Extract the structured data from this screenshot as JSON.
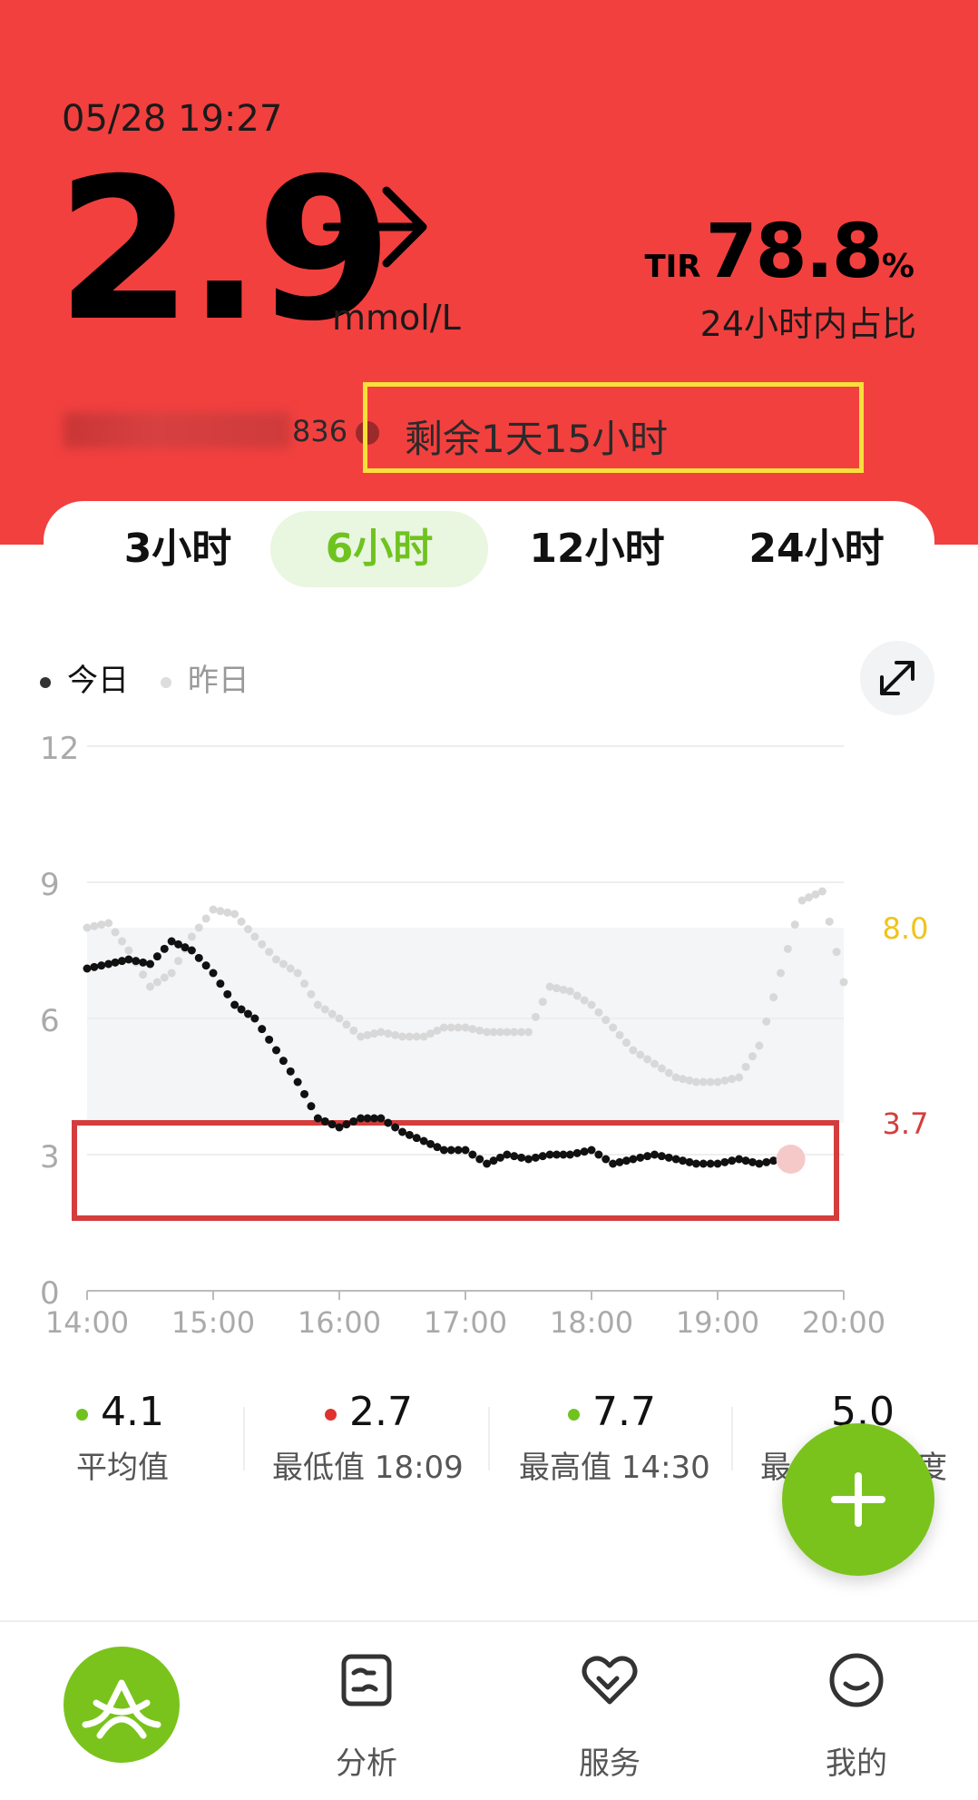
{
  "header": {
    "datetime": "05/28 19:27",
    "glucose_value": "2.9",
    "unit": "mmol/L",
    "trend_icon": "arrow-right-icon",
    "tir_label": "TIR",
    "tir_value": "78.8",
    "tir_pct": "%",
    "tir_sub": "24小时内占比",
    "serial_suffix": "836",
    "remaining": "剩余1天15小时",
    "colors": {
      "background": "#f2403f",
      "highlight_box": "#f7e03a"
    }
  },
  "tabs": [
    {
      "label": "3小时",
      "active": false
    },
    {
      "label": "6小时",
      "active": true
    },
    {
      "label": "12小时",
      "active": false
    },
    {
      "label": "24小时",
      "active": false
    }
  ],
  "legend": {
    "today": "今日",
    "yesterday": "昨日"
  },
  "expand_icon": "expand-arrows-icon",
  "chart_data": {
    "type": "scatter",
    "x_ticks": [
      "14:00",
      "15:00",
      "16:00",
      "17:00",
      "18:00",
      "19:00",
      "20:00"
    ],
    "y_ticks": [
      0,
      3,
      6,
      9,
      12
    ],
    "ylim": [
      0,
      12
    ],
    "target_range": {
      "low": 3.7,
      "high": 8.0,
      "low_label": "3.7",
      "high_label": "8.0"
    },
    "colors": {
      "today": "#111111",
      "yesterday": "#d8d8d8",
      "low_line": "#d43d3d",
      "high_line": "#f0c419",
      "target_band": "#f4f5f7",
      "annotation_box": "#d43d3d"
    },
    "series": [
      {
        "name": "今日",
        "x": [
          0,
          0.17,
          0.33,
          0.5,
          0.67,
          0.83,
          1.0,
          1.17,
          1.33,
          1.5,
          1.67,
          1.83,
          2.0,
          2.17,
          2.33,
          2.5,
          2.67,
          2.83,
          3.0,
          3.17,
          3.33,
          3.5,
          3.67,
          3.83,
          4.0,
          4.17,
          4.33,
          4.5,
          4.67,
          4.83,
          5.0,
          5.17,
          5.33,
          5.5
        ],
        "y": [
          7.1,
          7.2,
          7.3,
          7.2,
          7.7,
          7.5,
          7.0,
          6.3,
          6.0,
          5.3,
          4.6,
          3.8,
          3.6,
          3.8,
          3.8,
          3.5,
          3.3,
          3.1,
          3.1,
          2.8,
          3.0,
          2.9,
          3.0,
          3.0,
          3.1,
          2.8,
          2.9,
          3.0,
          2.9,
          2.8,
          2.8,
          2.9,
          2.8,
          2.9
        ]
      },
      {
        "name": "昨日",
        "x": [
          0,
          0.17,
          0.33,
          0.5,
          0.67,
          0.83,
          1.0,
          1.17,
          1.33,
          1.5,
          1.67,
          1.83,
          2.0,
          2.17,
          2.33,
          2.5,
          2.67,
          2.83,
          3.0,
          3.17,
          3.33,
          3.5,
          3.67,
          3.83,
          4.0,
          4.17,
          4.33,
          4.5,
          4.67,
          4.83,
          5.0,
          5.17,
          5.33,
          5.5,
          5.67,
          5.83,
          6.0
        ],
        "y": [
          8.0,
          8.1,
          7.5,
          6.7,
          7.0,
          7.8,
          8.4,
          8.3,
          7.8,
          7.3,
          7.0,
          6.3,
          6.0,
          5.6,
          5.7,
          5.6,
          5.6,
          5.8,
          5.8,
          5.7,
          5.7,
          5.7,
          6.7,
          6.6,
          6.3,
          5.8,
          5.3,
          5.0,
          4.7,
          4.6,
          4.6,
          4.7,
          5.4,
          7.0,
          8.6,
          8.8,
          6.8
        ]
      }
    ],
    "current_point": {
      "x": 5.58,
      "y": 2.9
    }
  },
  "stats": [
    {
      "value": "4.1",
      "label": "平均值",
      "dot": "#6fc31f"
    },
    {
      "value": "2.7",
      "label": "最低值 18:09",
      "dot": "#e0312f"
    },
    {
      "value": "7.7",
      "label": "最高值 14:30",
      "dot": "#6fc31f"
    },
    {
      "value": "5.0",
      "label_left": "最",
      "label_right": "度"
    }
  ],
  "fab_icon": "plus-icon",
  "nav": [
    {
      "label": "",
      "icon": "glucose-curve-icon"
    },
    {
      "label": "分析",
      "icon": "analysis-chart-icon"
    },
    {
      "label": "服务",
      "icon": "heart-service-icon"
    },
    {
      "label": "我的",
      "icon": "smiley-profile-icon"
    }
  ]
}
